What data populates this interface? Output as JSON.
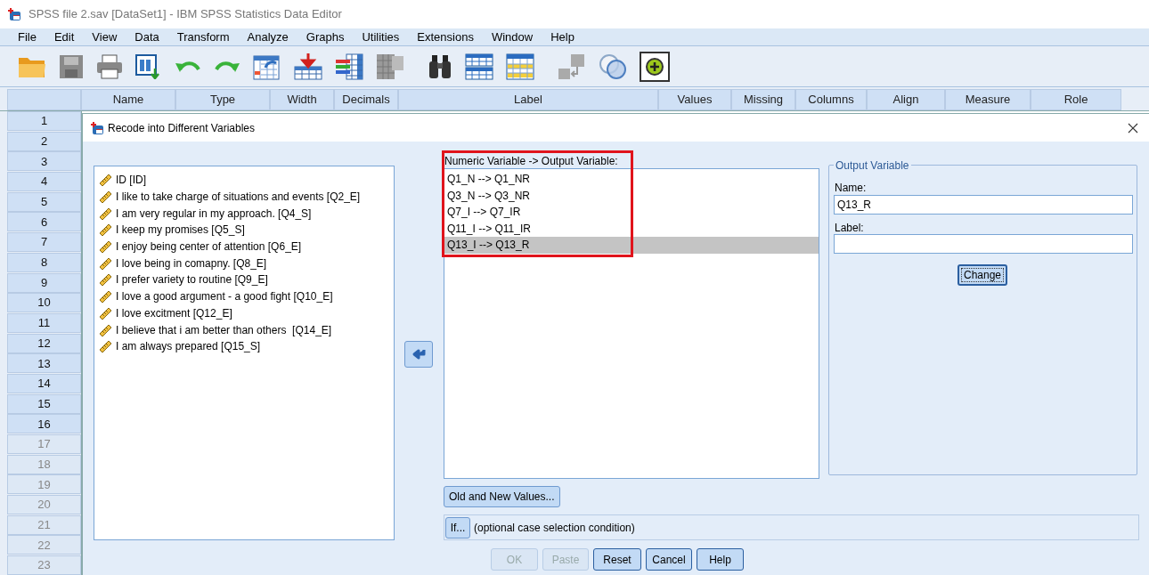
{
  "window": {
    "title": "SPSS file 2.sav [DataSet1] - IBM SPSS Statistics Data Editor"
  },
  "menu": [
    "File",
    "Edit",
    "View",
    "Data",
    "Transform",
    "Analyze",
    "Graphs",
    "Utilities",
    "Extensions",
    "Window",
    "Help"
  ],
  "grid": {
    "columns": [
      "Name",
      "Type",
      "Width",
      "Decimals",
      "Label",
      "Values",
      "Missing",
      "Columns",
      "Align",
      "Measure",
      "Role"
    ],
    "rows": [
      {
        "label": "1",
        "disabled": false
      },
      {
        "label": "2",
        "disabled": false
      },
      {
        "label": "3",
        "disabled": false
      },
      {
        "label": "4",
        "disabled": false
      },
      {
        "label": "5",
        "disabled": false
      },
      {
        "label": "6",
        "disabled": false
      },
      {
        "label": "7",
        "disabled": false
      },
      {
        "label": "8",
        "disabled": false
      },
      {
        "label": "9",
        "disabled": false
      },
      {
        "label": "10",
        "disabled": false
      },
      {
        "label": "11",
        "disabled": false
      },
      {
        "label": "12",
        "disabled": false
      },
      {
        "label": "13",
        "disabled": false
      },
      {
        "label": "14",
        "disabled": false
      },
      {
        "label": "15",
        "disabled": false
      },
      {
        "label": "16",
        "disabled": false
      },
      {
        "label": "17",
        "disabled": true
      },
      {
        "label": "18",
        "disabled": true
      },
      {
        "label": "19",
        "disabled": true
      },
      {
        "label": "20",
        "disabled": true
      },
      {
        "label": "21",
        "disabled": true
      },
      {
        "label": "22",
        "disabled": true
      },
      {
        "label": "23",
        "disabled": true
      }
    ]
  },
  "dialog": {
    "title": "Recode into Different Variables",
    "variables": [
      "ID [ID]",
      "I like to take charge of situations and events [Q2_E]",
      "I am very regular in my approach. [Q4_S]",
      "I keep my promises [Q5_S]",
      "I enjoy being center of attention [Q6_E]",
      "I love being in comapny. [Q8_E]",
      "I prefer variety to routine [Q9_E]",
      "I love a good argument - a good fight [Q10_E]",
      "I love excitment [Q12_E]",
      "I believe that i am better than others  [Q14_E]",
      "I am always prepared [Q15_S]"
    ],
    "mapping_label": "Numeric Variable -> Output Variable:",
    "mappings": [
      {
        "text": "Q1_N --> Q1_NR",
        "selected": false
      },
      {
        "text": "Q3_N --> Q3_NR",
        "selected": false
      },
      {
        "text": "Q7_I --> Q7_IR",
        "selected": false
      },
      {
        "text": "Q11_I --> Q11_IR",
        "selected": false
      },
      {
        "text": "Q13_I --> Q13_R",
        "selected": true
      }
    ],
    "output": {
      "legend": "Output Variable",
      "name_label": "Name:",
      "name_value": "Q13_R",
      "label_label": "Label:",
      "change_button": "Change"
    },
    "old_new_button": "Old and New Values...",
    "if_button": "If...",
    "if_text": "(optional case selection condition)",
    "buttons": [
      {
        "label": "OK",
        "disabled": true
      },
      {
        "label": "Paste",
        "disabled": true
      },
      {
        "label": "Reset",
        "disabled": false
      },
      {
        "label": "Cancel",
        "disabled": false
      },
      {
        "label": "Help",
        "disabled": false
      }
    ]
  }
}
